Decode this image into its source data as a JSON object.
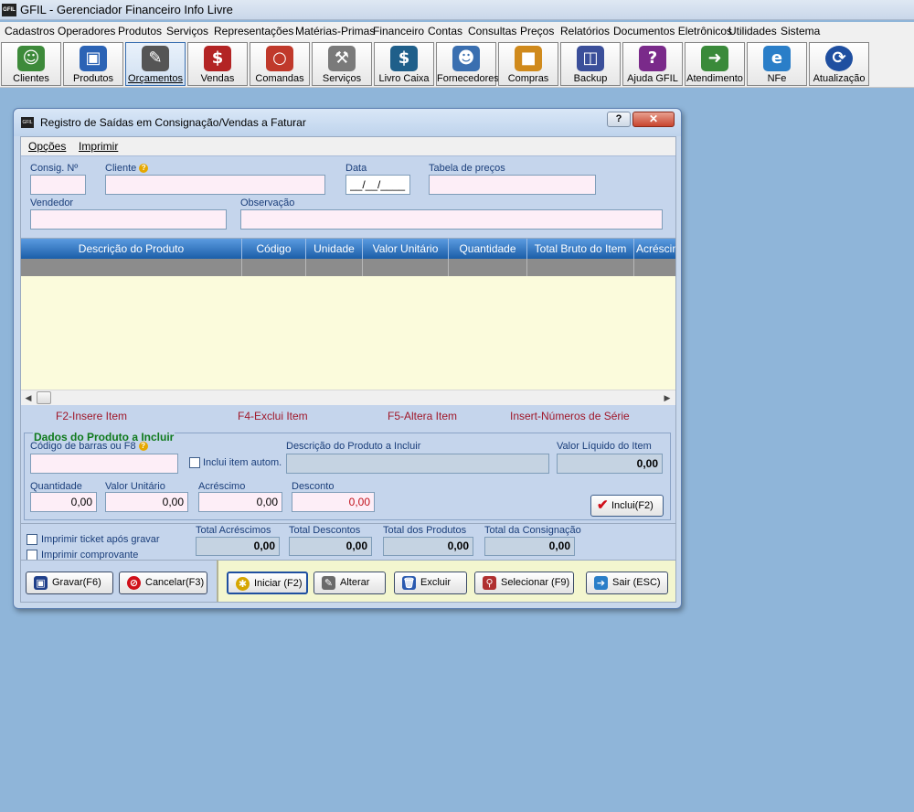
{
  "app": {
    "logo_text": "GFIL",
    "title": "GFIL - Gerenciador Financeiro Info Livre"
  },
  "menu": [
    "Cadastros",
    "Operadores",
    "Produtos",
    "Serviços",
    "Representações",
    "Matérias-Primas",
    "Financeiro",
    "Contas",
    "Consultas",
    "Preços",
    "Relatórios",
    "Documentos Eletrônicos",
    "Utilidades",
    "Sistema"
  ],
  "toolbar": [
    {
      "label": "Clientes",
      "icon": "users-icon",
      "color": "#3d8a3a"
    },
    {
      "label": "Produtos",
      "icon": "monitor-icon",
      "color": "#2b63b5"
    },
    {
      "label": "Orçamentos",
      "icon": "notepad-icon",
      "color": "#555555"
    },
    {
      "label": "Vendas",
      "icon": "money-bag-icon",
      "color": "#b32424"
    },
    {
      "label": "Comandas",
      "icon": "plate-icon",
      "color": "#c0392b"
    },
    {
      "label": "Serviços",
      "icon": "tools-icon",
      "color": "#7a7a7a"
    },
    {
      "label": "Livro Caixa",
      "icon": "ledger-icon",
      "color": "#1f5f8a"
    },
    {
      "label": "Fornecedores",
      "icon": "supplier-icon",
      "color": "#3a6fb0"
    },
    {
      "label": "Compras",
      "icon": "boxes-icon",
      "color": "#d08a1c"
    },
    {
      "label": "Backup",
      "icon": "floppy-icon",
      "color": "#3b4f9a"
    },
    {
      "label": "Ajuda GFIL",
      "icon": "help-book-icon",
      "color": "#7a2a8a"
    },
    {
      "label": "Atendimento",
      "icon": "exit-sign-icon",
      "color": "#3a8a3a"
    },
    {
      "label": "NFe",
      "icon": "internet-explorer-icon",
      "color": "#2a7ec8"
    },
    {
      "label": "Atualização",
      "icon": "refresh-icon",
      "color": "#1f4fa0"
    }
  ],
  "dialog": {
    "logo_text": "GFIL",
    "title": "Registro de Saídas em Consignação/Vendas a Faturar",
    "help_label": "?",
    "close_label": "✕",
    "menu": {
      "options": "Opções",
      "print": "Imprimir"
    },
    "header": {
      "consig_label": "Consig. Nº",
      "consig_value": "",
      "cliente_label": "Cliente",
      "cliente_value": "",
      "data_label": "Data",
      "data_value": "__/__/____",
      "tabela_label": "Tabela de preços",
      "tabela_value": "",
      "vendedor_label": "Vendedor",
      "vendedor_value": "",
      "observacao_label": "Observação",
      "observacao_value": ""
    },
    "grid": {
      "columns": [
        "Descrição do Produto",
        "Código",
        "Unidade",
        "Valor Unitário",
        "Quantidade",
        "Total Bruto do Item",
        "Acréscim"
      ]
    },
    "shortcuts": [
      "F2-Insere Item",
      "F4-Exclui Item",
      "F5-Altera Item",
      "Insert-Números de Série"
    ],
    "product": {
      "legend": "Dados do Produto a Incluir",
      "barcode_label": "Código de barras ou F8",
      "barcode_value": "",
      "auto_include_label": "Inclui item autom.",
      "description_label": "Descrição do Produto a Incluir",
      "description_value": "",
      "net_value_label": "Valor Líquido do Item",
      "net_value": "0,00",
      "quantity_label": "Quantidade",
      "quantity_value": "0,00",
      "unit_value_label": "Valor Unitário",
      "unit_value": "0,00",
      "surcharge_label": "Acréscimo",
      "surcharge_value": "0,00",
      "discount_label": "Desconto",
      "discount_value": "0,00",
      "include_button": "Inclui(F2)"
    },
    "totals": {
      "print_ticket_label": "Imprimir ticket após gravar",
      "print_receipt_label": "Imprimir comprovante",
      "surcharges_label": "Total Acréscimos",
      "surcharges_value": "0,00",
      "discounts_label": "Total Descontos",
      "discounts_value": "0,00",
      "products_label": "Total dos Produtos",
      "products_value": "0,00",
      "consignment_label": "Total da Consignação",
      "consignment_value": "0,00"
    },
    "actions": {
      "save": "Gravar(F6)",
      "cancel": "Cancelar(F3)",
      "start": "Iniciar (F2)",
      "edit": "Alterar",
      "delete": "Excluir",
      "select": "Selecionar (F9)",
      "exit": "Sair (ESC)"
    }
  }
}
